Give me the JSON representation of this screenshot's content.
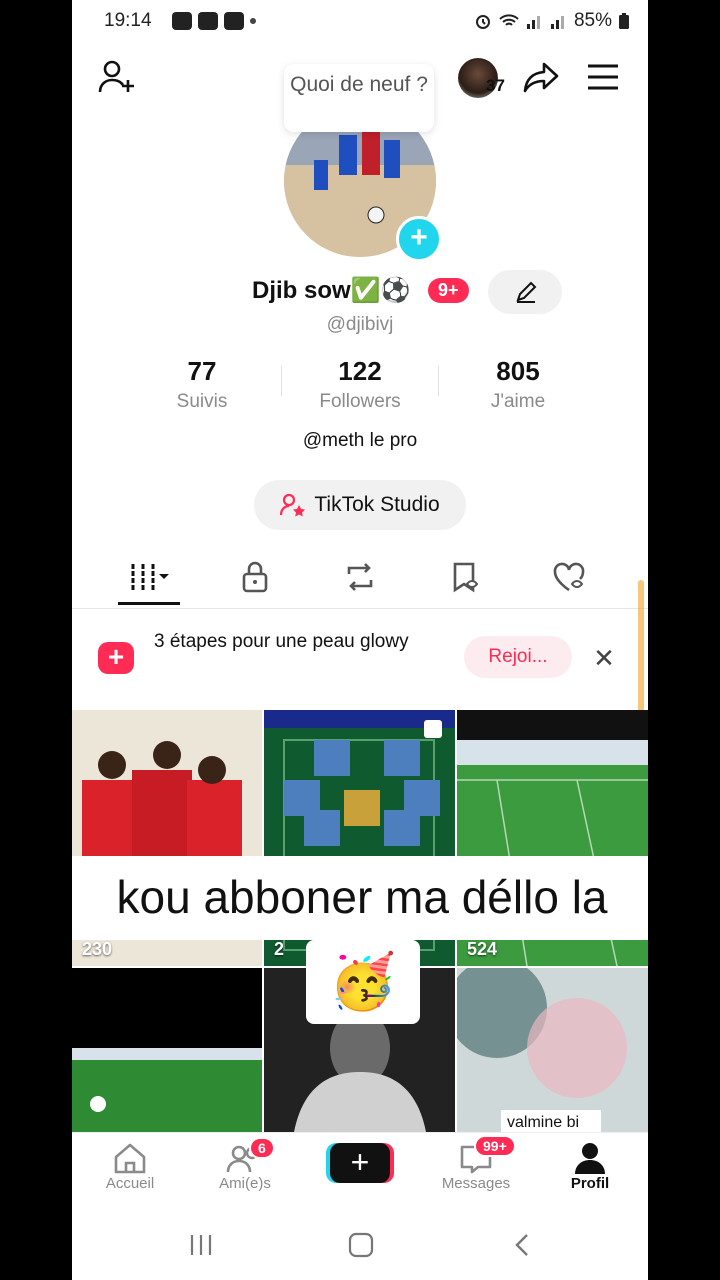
{
  "status_bar": {
    "time": "19:14",
    "battery": "85%"
  },
  "header": {
    "whats_new": "Quoi de neuf ?",
    "friend_count": "37"
  },
  "profile": {
    "display_name": "Djib sow✅⚽",
    "notif_badge": "9+",
    "username": "@djibivj",
    "stats": [
      {
        "value": "77",
        "label": "Suivis"
      },
      {
        "value": "122",
        "label": "Followers"
      },
      {
        "value": "805",
        "label": "J'aime"
      }
    ],
    "bio": "@meth le pro",
    "studio_label": "TikTok Studio"
  },
  "promo": {
    "text": "3 étapes pour une peau glowy",
    "button": "Rejoi..."
  },
  "videos": [
    {
      "views": "230"
    },
    {
      "views": "2"
    },
    {
      "views": "524"
    },
    {
      "views": ""
    },
    {
      "views": ""
    },
    {
      "label": "valmine bi"
    }
  ],
  "overlay": {
    "caption": "kou abboner ma déllo la",
    "emoji": "🥳"
  },
  "bottom_nav": {
    "home": "Accueil",
    "friends": "Ami(e)s",
    "friends_badge": "6",
    "messages": "Messages",
    "messages_badge": "99+",
    "profile": "Profil"
  },
  "colors": {
    "accent": "#fe2c55",
    "cyan": "#20d5ec"
  }
}
